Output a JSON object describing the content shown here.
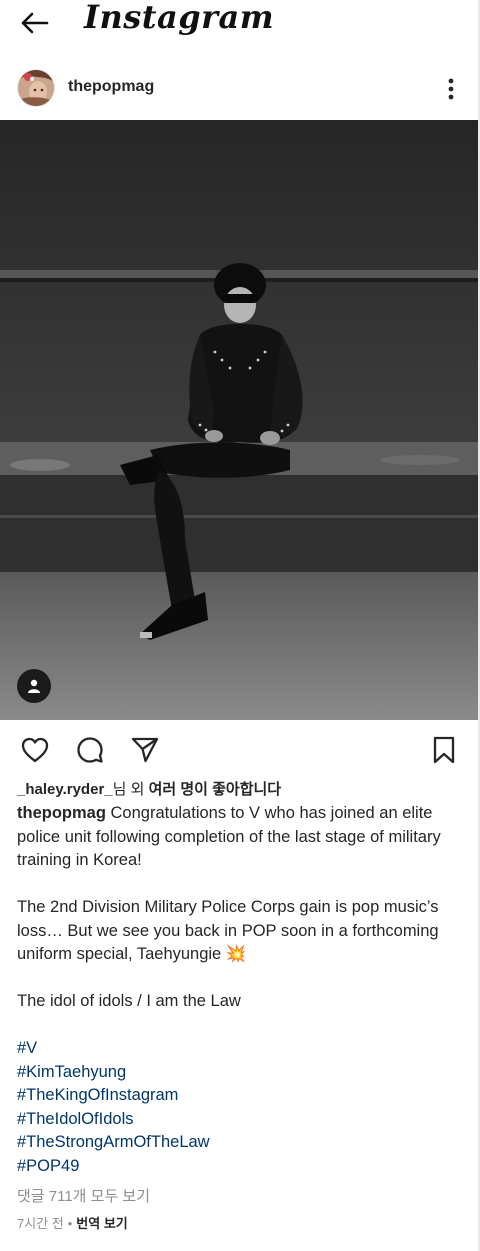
{
  "app": {
    "logo_text": "Instagram"
  },
  "post": {
    "username": "thepopmag",
    "likes": {
      "user": "_haley.ryder_",
      "suffix_plain": "님 외 ",
      "suffix_bold": "여러 명이 좋아합니다"
    },
    "caption": {
      "username": "thepopmag",
      "para1": "Congratulations to V who has joined an elite police unit following completion of the last stage of military training in Korea!",
      "para2": "The 2nd Division Military Police Corps gain is pop music’s loss… But we see you back in POP soon in a forthcoming uniform special, Taehyungie 💥",
      "para3": "The idol of idols / I am the Law",
      "hashtags": [
        "#V",
        "#KimTaehyung",
        "#TheKingOfInstagram",
        "#TheIdolOfIdols",
        "#TheStrongArmOfTheLaw",
        "#POP49"
      ]
    },
    "view_comments": "댓글 711개 모두 보기",
    "time_ago": "7시간 전",
    "separator": "•",
    "translate_label": "번역 보기"
  },
  "icons": {
    "back": "back-arrow-icon",
    "more": "more-vertical-icon",
    "tag": "person-tag-icon",
    "like": "heart-icon",
    "comment": "comment-icon",
    "share": "send-icon",
    "save": "bookmark-icon"
  },
  "colors": {
    "text": "#262626",
    "secondary": "#8e8e8e",
    "hashtag": "#00376b",
    "background": "#ffffff"
  }
}
